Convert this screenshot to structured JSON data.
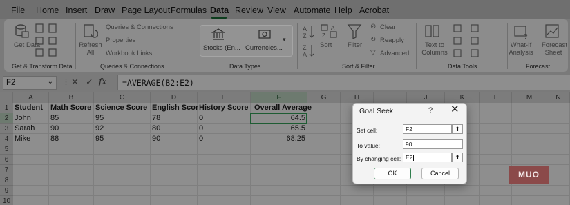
{
  "menu": [
    "File",
    "Home",
    "Insert",
    "Draw",
    "Page Layout",
    "Formulas",
    "Data",
    "Review",
    "View",
    "Automate",
    "Help",
    "Acrobat"
  ],
  "active_tab": "Data",
  "ribbon": {
    "get_data": "Get Data",
    "get_transform_label": "Get & Transform Data",
    "refresh_all": "Refresh All",
    "queries_connections": "Queries & Connections",
    "properties": "Properties",
    "workbook_links": "Workbook Links",
    "queries_group_label": "Queries & Connections",
    "stocks": "Stocks (En...",
    "currencies": "Currencies...",
    "data_types_label": "Data Types",
    "sort": "Sort",
    "filter": "Filter",
    "clear": "Clear",
    "reapply": "Reapply",
    "advanced": "Advanced",
    "sort_filter_label": "Sort & Filter",
    "text_to_columns": "Text to Columns",
    "data_tools_label": "Data Tools",
    "what_if": "What-If Analysis",
    "forecast_sheet": "Forecast Sheet",
    "forecast_label": "Forecast"
  },
  "formula_bar": {
    "name_box": "F2",
    "fx": "fx",
    "formula": "=AVERAGE(B2:E2)"
  },
  "sheet": {
    "columns": [
      "A",
      "B",
      "C",
      "D",
      "E",
      "F",
      "G",
      "H",
      "I",
      "J",
      "K",
      "L",
      "M",
      "N"
    ],
    "rows": [
      "1",
      "2",
      "3",
      "4",
      "5",
      "6",
      "7",
      "8",
      "9",
      "10"
    ],
    "headers": [
      "Student",
      "Math Score",
      "Science Score",
      "English Score",
      "History Score",
      "Overall Average"
    ],
    "data": [
      [
        "John",
        "85",
        "95",
        "78",
        "0",
        "64.5"
      ],
      [
        "Sarah",
        "90",
        "92",
        "80",
        "0",
        "65.5"
      ],
      [
        "Mike",
        "88",
        "95",
        "90",
        "0",
        "68.25"
      ]
    ]
  },
  "goal_seek": {
    "title": "Goal Seek",
    "help": "?",
    "close": "✕",
    "set_cell_label": "Set cell:",
    "set_cell_value": "F2",
    "to_value_label": "To value:",
    "to_value_value": "90",
    "by_changing_label": "By changing cell:",
    "by_changing_value": "E2",
    "ok": "OK",
    "cancel": "Cancel"
  },
  "watermark": "MUO",
  "colors": {
    "accent": "#1e5c33",
    "dialog_bg": "#f3f3f3"
  }
}
